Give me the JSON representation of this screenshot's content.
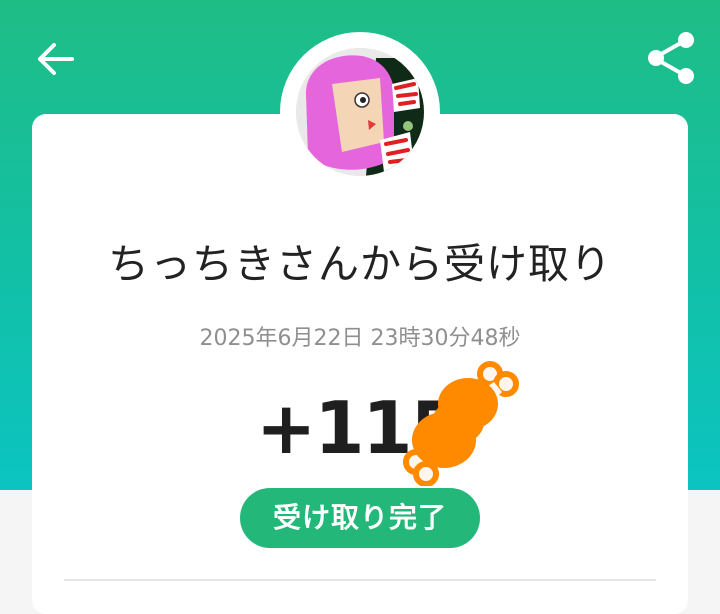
{
  "header": {
    "back_icon": "arrow-left-icon",
    "share_icon": "share-icon",
    "colors": {
      "gradient_top": "#1fbd86",
      "gradient_bottom": "#0bc4c2"
    }
  },
  "sender": {
    "avatar_text": "ちっちき"
  },
  "receipt": {
    "title": "ちっちきさんから受け取り",
    "timestamp": "2025年6月22日 23時30分48秒",
    "amount": "+115",
    "currency_icon": "meat-icon",
    "status": "受け取り完了",
    "status_color": "#23b87a",
    "currency_color": "#ff8a00"
  }
}
